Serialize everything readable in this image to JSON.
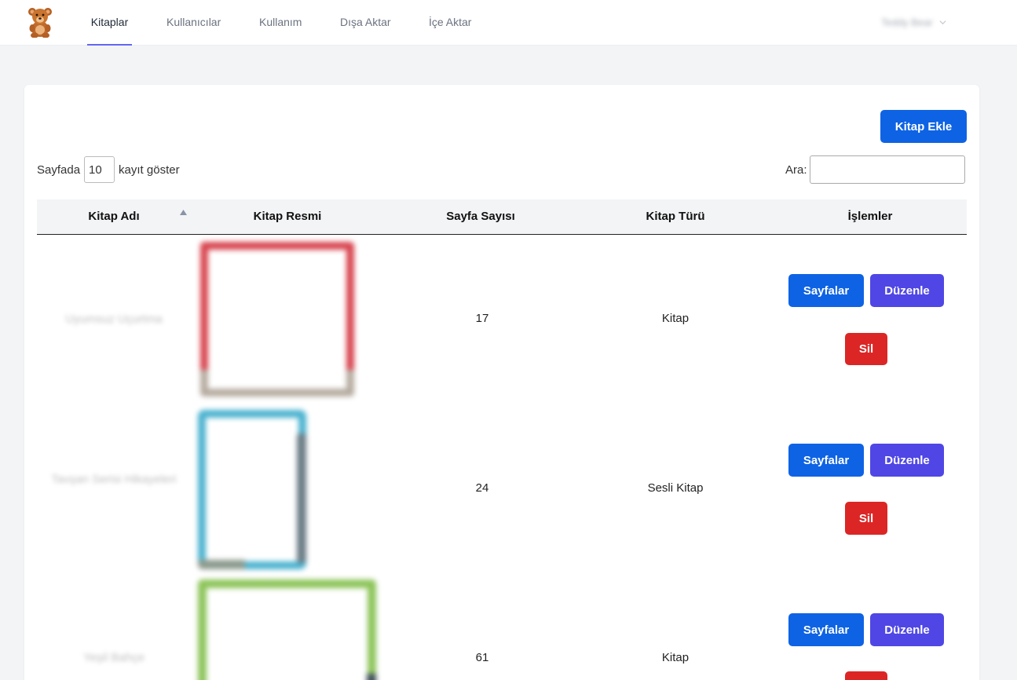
{
  "nav": {
    "items": [
      {
        "label": "Kitaplar",
        "active": true
      },
      {
        "label": "Kullanıcılar"
      },
      {
        "label": "Kullanım"
      },
      {
        "label": "Dışa Aktar"
      },
      {
        "label": "İçe Aktar"
      }
    ],
    "user_name": "Teddy Bear",
    "accent": "#6366f1"
  },
  "toolbar": {
    "add_label": "Kitap Ekle"
  },
  "length": {
    "prefix": "Sayfada",
    "value": "10",
    "suffix": "kayıt göster"
  },
  "search": {
    "label": "Ara:",
    "value": ""
  },
  "table": {
    "headers": [
      "Kitap Adı",
      "Kitap Resmi",
      "Sayfa Sayısı",
      "Kitap Türü",
      "İşlemler"
    ],
    "sort_column": "Kitap Adı",
    "rows": [
      {
        "name": "Uyumsuz Uçurtma",
        "pages": "17",
        "type": "Kitap",
        "cover_color": "#d8454f"
      },
      {
        "name": "Tavşan Serisi Hikayeleri",
        "pages": "24",
        "type": "Sesli Kitap",
        "cover_color": "#4bb2cf"
      },
      {
        "name": "Yeşil Bahçe",
        "pages": "61",
        "type": "Kitap",
        "cover_color": "#8dc45a"
      }
    ],
    "actions": {
      "pages_label": "Sayfalar",
      "edit_label": "Düzenle",
      "delete_label": "Sil"
    }
  },
  "colors": {
    "primary": "#0e63e4",
    "edit": "#4f46e5",
    "danger": "#dc2626"
  },
  "icons": [
    "teddy-bear-logo-icon",
    "chevron-down-icon",
    "sort-ascending-icon"
  ]
}
